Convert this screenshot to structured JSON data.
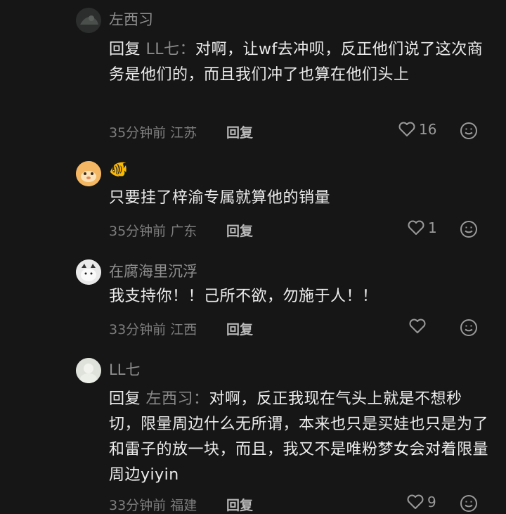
{
  "comments": [
    {
      "username": "左西习",
      "reply_prefix": "回复",
      "reply_target": "LL七",
      "reply_sep": "：",
      "text": "对啊，让wf去冲呗，反正他们说了这次商务是他们的，而且我们冲了也算在他们头上",
      "time": "35分钟前",
      "location": "江苏",
      "reply_label": "回复",
      "likes": "16"
    },
    {
      "username": "🐠",
      "text": "只要挂了梓渝专属就算他的销量",
      "time": "35分钟前",
      "location": "广东",
      "reply_label": "回复",
      "likes": "1"
    },
    {
      "username": "在腐海里沉浮",
      "text": "我支持你！！己所不欲，勿施于人！！",
      "time": "33分钟前",
      "location": "江西",
      "reply_label": "回复",
      "likes": ""
    },
    {
      "username": "LL七",
      "reply_prefix": "回复",
      "reply_target": "左西习",
      "reply_sep": "：",
      "text": "对啊，反正我现在气头上就是不想秒切，限量周边什么无所谓，本来也只是买娃也只是为了和雷子的放一块，而且，我又不是唯粉梦女会对着限量周边yiyin",
      "time": "33分钟前",
      "location": "福建",
      "reply_label": "回复",
      "likes": "9"
    }
  ],
  "colors": {
    "background": "#161616",
    "text": "#ececec",
    "muted": "#8f8f8f"
  },
  "icons": [
    "avatar",
    "heart-icon",
    "emoji-icon"
  ]
}
